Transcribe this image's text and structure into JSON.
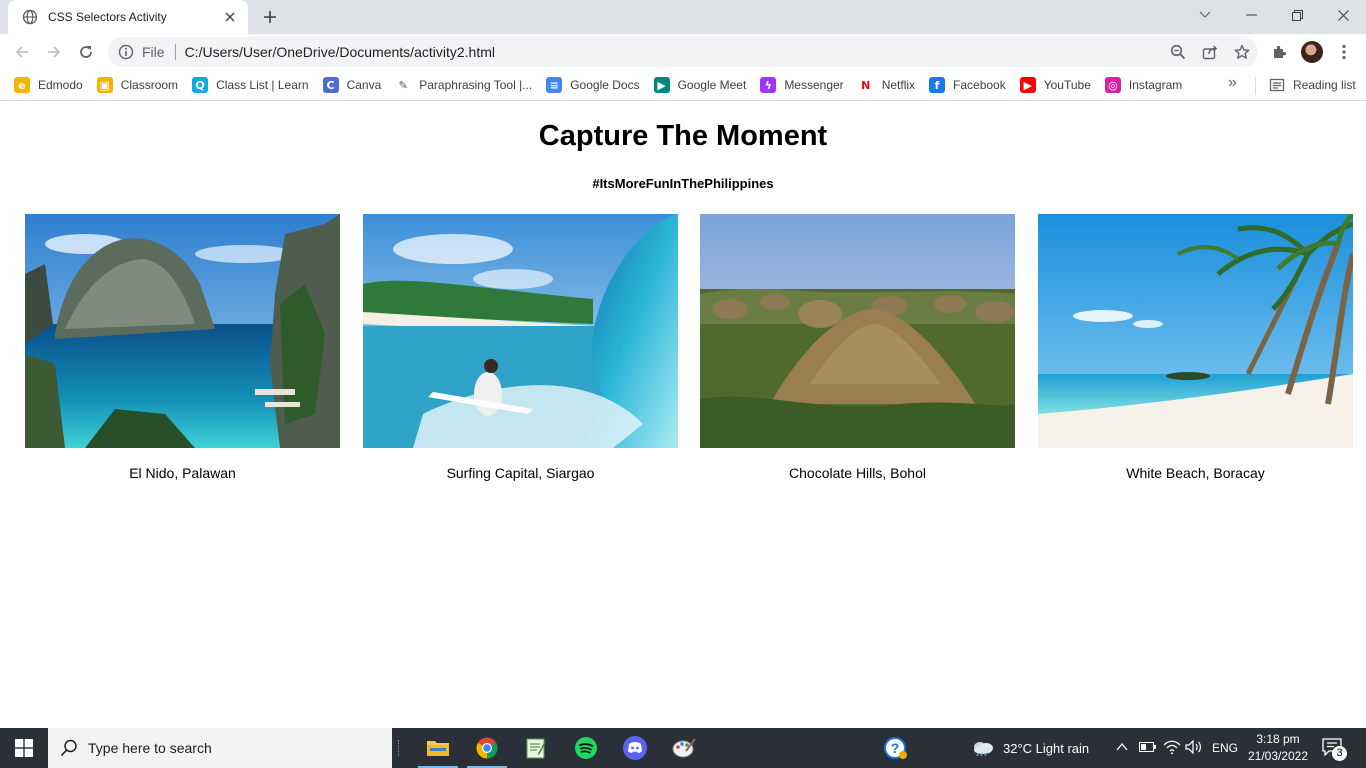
{
  "browser": {
    "tab_title": "CSS Selectors Activity",
    "omnibox_scheme": "File",
    "url": "C:/Users/User/OneDrive/Documents/activity2.html",
    "bookmarks": [
      {
        "label": "Edmodo",
        "icon": "edmodo-icon",
        "color": "#f5b400",
        "glyph": "e"
      },
      {
        "label": "Classroom",
        "icon": "classroom-icon",
        "color": "#f4b400",
        "glyph": "▣"
      },
      {
        "label": "Class List | Learn",
        "icon": "learn-icon",
        "color": "#12a9e3",
        "glyph": "Q"
      },
      {
        "label": "Canva",
        "icon": "canva-icon",
        "color": "#4f6bd6",
        "glyph": "C"
      },
      {
        "label": "Paraphrasing Tool |...",
        "icon": "quill-icon",
        "color": "#ffffff",
        "glyph": "✎"
      },
      {
        "label": "Google Docs",
        "icon": "docs-icon",
        "color": "#4285f4",
        "glyph": "≡"
      },
      {
        "label": "Google Meet",
        "icon": "meet-icon",
        "color": "#00897b",
        "glyph": "▶"
      },
      {
        "label": "Messenger",
        "icon": "messenger-icon",
        "color": "#a033ff",
        "glyph": "ϟ"
      },
      {
        "label": "Netflix",
        "icon": "netflix-icon",
        "color": "#ffffff",
        "glyph": "N"
      },
      {
        "label": "Facebook",
        "icon": "facebook-icon",
        "color": "#1877f2",
        "glyph": "f"
      },
      {
        "label": "YouTube",
        "icon": "youtube-icon",
        "color": "#ff0000",
        "glyph": "▶"
      },
      {
        "label": "Instagram",
        "icon": "instagram-icon",
        "color": "#d6249f",
        "glyph": "◎"
      }
    ],
    "reading_list_label": "Reading list",
    "more_glyph": "»"
  },
  "page": {
    "title": "Capture The Moment",
    "subtitle": "#ItsMoreFunInThePhilippines",
    "cards": [
      {
        "caption": "El Nido, Palawan",
        "image": "el-nido-photo"
      },
      {
        "caption": "Surfing Capital, Siargao",
        "image": "siargao-surf-photo"
      },
      {
        "caption": "Chocolate Hills, Bohol",
        "image": "chocolate-hills-photo"
      },
      {
        "caption": "White Beach, Boracay",
        "image": "boracay-beach-photo"
      }
    ]
  },
  "taskbar": {
    "search_placeholder": "Type here to search",
    "weather": "32°C  Light rain",
    "language": "ENG",
    "time": "3:18 pm",
    "date": "21/03/2022",
    "notification_count": "3",
    "apps": [
      "file-explorer-icon",
      "chrome-icon",
      "notepad-icon",
      "spotify-icon",
      "discord-icon",
      "paint-icon"
    ]
  },
  "colors": {
    "tabstrip": "#dee1e6",
    "taskbar": "#2b2f38",
    "accent": "#1a73e8"
  }
}
